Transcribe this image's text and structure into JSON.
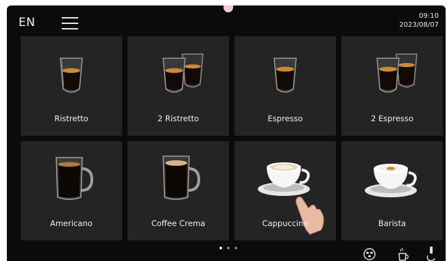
{
  "header": {
    "language": "EN",
    "time": "09:10",
    "date": "2023/08/07",
    "menu_icon": "hamburger-menu-icon"
  },
  "drinks": [
    {
      "label": "Ristretto",
      "icon": "single-glass-icon"
    },
    {
      "label": "2 Ristretto",
      "icon": "double-glass-icon"
    },
    {
      "label": "Espresso",
      "icon": "single-glass-icon"
    },
    {
      "label": "2 Espresso",
      "icon": "double-glass-icon"
    },
    {
      "label": "Americano",
      "icon": "tall-mug-icon"
    },
    {
      "label": "Coffee Crema",
      "icon": "tall-mug-icon"
    },
    {
      "label": "Cappuccino",
      "icon": "cup-and-saucer-icon"
    },
    {
      "label": "Barista",
      "icon": "cup-and-saucer-icon"
    }
  ],
  "pagination": {
    "pages": 3,
    "current": 1
  },
  "bottom_bar": [
    "beans-icon",
    "cleaning-icon",
    "hot-water-icon"
  ],
  "colors": {
    "background": "#0b0b0b",
    "tile": "#242424",
    "crema": "#c98a3a",
    "text": "#f0f0f0"
  }
}
